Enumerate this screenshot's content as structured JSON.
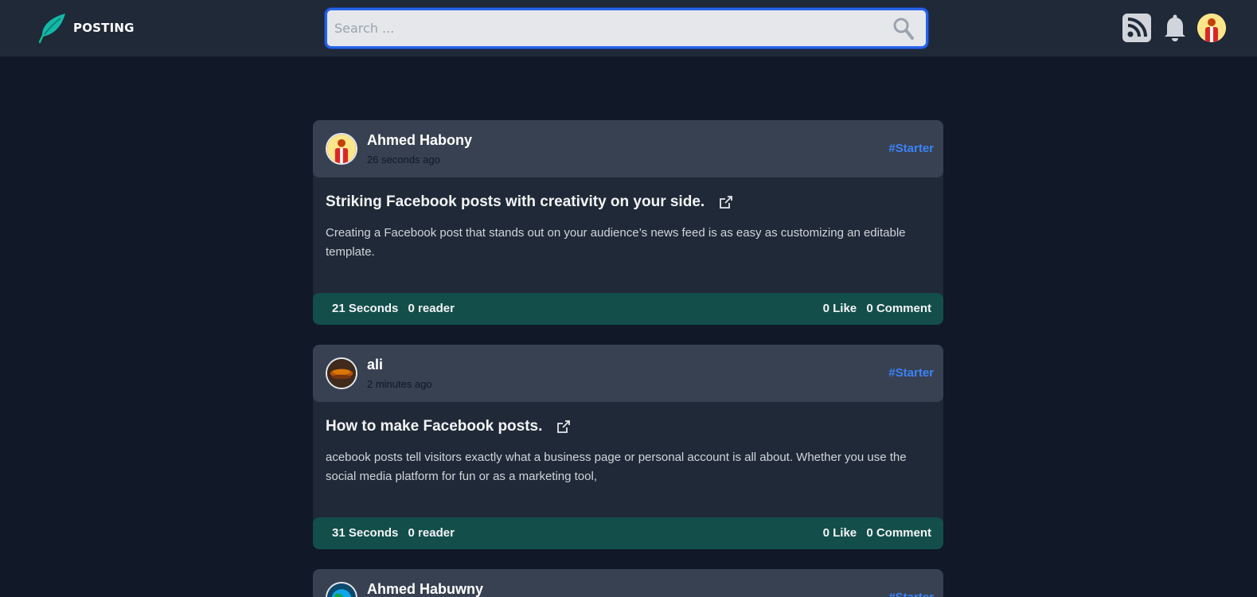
{
  "header": {
    "brand_name": "POSTING",
    "search": {
      "placeholder": "Search ...",
      "value": ""
    },
    "icons": [
      "feather-logo-icon",
      "search-icon",
      "rss-feed-icon",
      "bell-icon",
      "user-avatar"
    ]
  },
  "colors": {
    "page_bg": "#111827",
    "topbar_bg": "#1f2937",
    "card_bg": "#1f2937",
    "card_header_bg": "#374151",
    "card_footer_bg": "#134e4a",
    "accent_blue": "#3b82f6",
    "brand_green": "#10b981"
  },
  "posts": [
    {
      "author": "Ahmed Habony",
      "posted_ago": "26 seconds ago",
      "tag": "#Starter",
      "title": "Striking Facebook posts with creativity on your side.",
      "excerpt": "Creating a Facebook post that stands out on your audience’s news feed is as easy as customizing an editable template.",
      "read_time": "21 Seconds",
      "readers": "0 reader",
      "likes": "0 Like",
      "comments": "0 Comment"
    },
    {
      "author": "ali",
      "posted_ago": "2 minutes ago",
      "tag": "#Starter",
      "title": "How to make Facebook posts.",
      "excerpt": "acebook posts tell visitors exactly what a business page or personal account is all about. Whether you use the social media platform for fun or as a marketing tool,",
      "read_time": "31 Seconds",
      "readers": "0 reader",
      "likes": "0 Like",
      "comments": "0 Comment"
    },
    {
      "author": "Ahmed Habuwny",
      "tag": "#Starter"
    }
  ]
}
